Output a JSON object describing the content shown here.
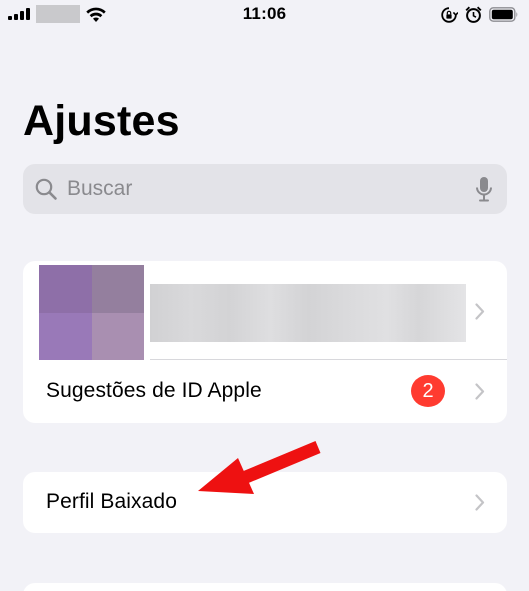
{
  "status_bar": {
    "time": "11:06"
  },
  "page": {
    "title": "Ajustes"
  },
  "search": {
    "placeholder": "Buscar"
  },
  "account_card": {
    "suggestions_label": "Sugestões de ID Apple",
    "badge_count": "2"
  },
  "profile_card": {
    "label": "Perfil Baixado"
  },
  "colors": {
    "background": "#f2f2f7",
    "card": "#ffffff",
    "search_fill": "#e3e3e8",
    "badge": "#ff3b30",
    "annotation_arrow": "#ee1111",
    "chevron": "#c4c4c7"
  },
  "icons": [
    "signal-icon",
    "wifi-icon",
    "rotation-lock-icon",
    "alarm-icon",
    "battery-icon",
    "search-icon",
    "microphone-icon",
    "chevron-right-icon"
  ]
}
